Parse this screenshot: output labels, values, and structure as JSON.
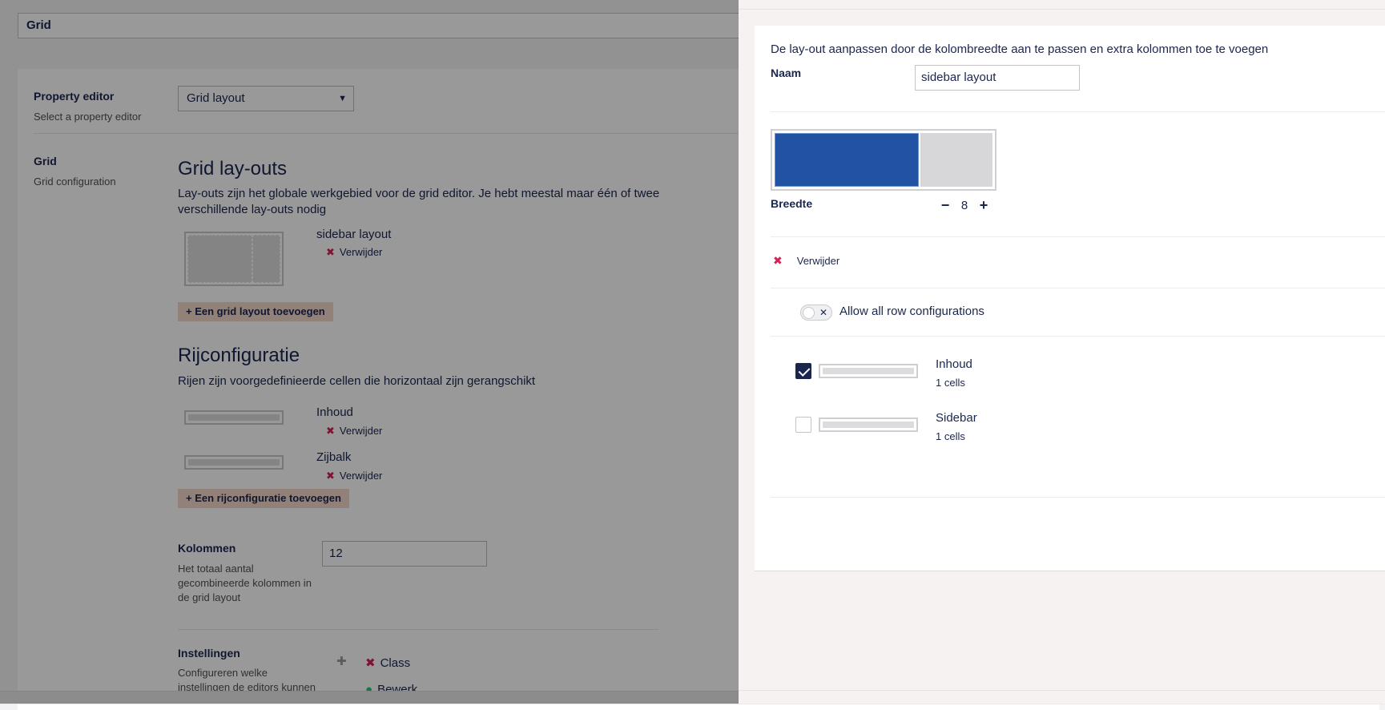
{
  "background": {
    "name_field": "Grid",
    "property_editor": {
      "label": "Property editor",
      "description": "Select a property editor",
      "selected": "Grid layout"
    },
    "grid": {
      "label": "Grid",
      "description": "Grid configuration"
    },
    "layouts": {
      "heading": "Grid lay-outs",
      "text_line1": "Lay-outs zijn het globale werkgebied voor de grid editor. Je hebt meestal maar één of twee",
      "text_line2": "verschillende lay-outs nodig",
      "items": [
        {
          "name": "sidebar layout",
          "delete_label": "Verwijder"
        }
      ],
      "add_label": "Een grid layout toevoegen"
    },
    "rows": {
      "heading": "Rijconfiguratie",
      "text": "Rijen zijn voorgedefinieerde cellen die horizontaal zijn gerangschikt",
      "items": [
        {
          "name": "Inhoud",
          "delete_label": "Verwijder"
        },
        {
          "name": "Zijbalk",
          "delete_label": "Verwijder"
        }
      ],
      "add_label": "Een rijconfiguratie toevoegen"
    },
    "columns": {
      "label": "Kolommen",
      "description_line1": "Het totaal aantal",
      "description_line2": "gecombineerde kolommen in",
      "description_line3": "de grid layout",
      "value": "12"
    },
    "settings": {
      "label": "Instellingen",
      "description_line1": "Configureren welke",
      "description_line2": "instellingen de editors kunnen",
      "first_item": "Class",
      "second_item_partial": "Bewerk"
    }
  },
  "drawer": {
    "description": "De lay-out aanpassen door de kolombreedte aan te passen en extra kolommen toe te voegen",
    "name_label": "Naam",
    "name_value": "sidebar layout",
    "preview": {
      "total_columns": 12,
      "selected_cell_width": 8
    },
    "width_label": "Breedte",
    "width_value": "8",
    "delete_label": "Verwijder",
    "allow_all_label": "Allow all row configurations",
    "rows": [
      {
        "name": "Inhoud",
        "cells": "1 cells",
        "checked": true
      },
      {
        "name": "Sidebar",
        "cells": "1 cells",
        "checked": false
      }
    ]
  },
  "colors": {
    "primary": "#1b264f",
    "selected_cell": "#2152a3",
    "danger": "#d42054",
    "add_button": "#f3d8c9"
  }
}
